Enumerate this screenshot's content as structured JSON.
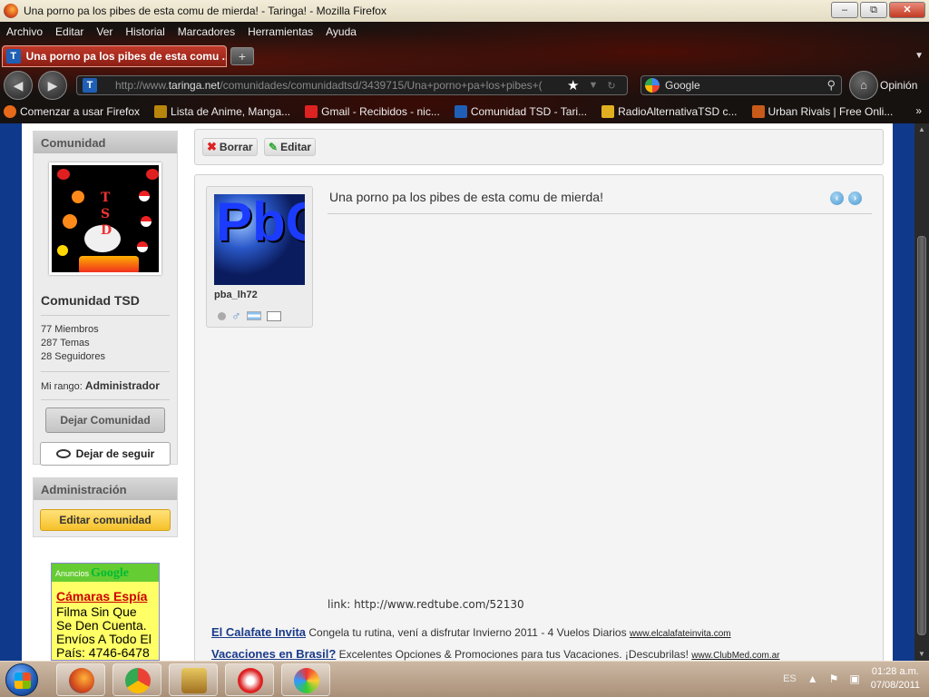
{
  "window": {
    "title": "Una porno pa los pibes de esta comu de mierda! - Taringa! - Mozilla Firefox",
    "minimize": "–",
    "maximize": "⧉",
    "close": "✕"
  },
  "menu": [
    "Archivo",
    "Editar",
    "Ver",
    "Historial",
    "Marcadores",
    "Herramientas",
    "Ayuda"
  ],
  "tab": {
    "favicon": "T",
    "label": "Una porno pa los pibes de esta comu ...",
    "close": "✕",
    "new_tab": "+"
  },
  "navbar": {
    "back": "◀",
    "forward": "▶",
    "site_icon": "T",
    "url_prefix": "http://www.",
    "url_domain": "taringa.net",
    "url_path": "/comunidades/comunidadtsd/3439715/Una+porno+pa+los+pibes+(",
    "search_text": "Google",
    "home_label": "⌂",
    "opinion": "Opinión"
  },
  "bookmarks": [
    {
      "label": "Comenzar a usar Firefox",
      "icon": "firefox-icon",
      "color": "#e66a1a"
    },
    {
      "label": "Lista de Anime, Manga...",
      "icon": "anime-icon",
      "color": "#b8860b"
    },
    {
      "label": "Gmail - Recibidos - nic...",
      "icon": "gmail-icon",
      "color": "#d22"
    },
    {
      "label": "Comunidad TSD - Tari...",
      "icon": "taringa-icon",
      "color": "#1f5fb5"
    },
    {
      "label": "RadioAlternativaTSD c...",
      "icon": "radio-icon",
      "color": "#e0b020"
    },
    {
      "label": "Urban Rivals | Free Onli...",
      "icon": "urban-icon",
      "color": "#c85a1a"
    }
  ],
  "bookmarks_more": "»",
  "sidebar": {
    "community_header": "Comunidad",
    "community_name": "Comunidad TSD",
    "logo_text": [
      "T",
      "S",
      "D"
    ],
    "stats": [
      "77 Miembros",
      "287 Temas",
      "28 Seguidores"
    ],
    "rank_label": "Mi rango:",
    "rank_value": "Administrador",
    "leave_button": "Dejar Comunidad",
    "unfollow_button": "Dejar de seguir",
    "admin_header": "Administración",
    "edit_button": "Editar comunidad"
  },
  "ad_box": {
    "label": "Anuncios",
    "brand": "Google",
    "title": "Cámaras Espía",
    "body": "Filma Sin Que Se Den Cuenta. Envíos A Todo El País: 4746-6478"
  },
  "toolbar": {
    "delete_label": "Borrar",
    "edit_label": "Editar"
  },
  "post": {
    "title": "Una porno pa los pibes de esta comu de mierda!",
    "author": "pba_lh72",
    "avatar_letters": "PbC",
    "prev": "‹",
    "next": "›",
    "link_text": "link: http://www.redtube.com/52130"
  },
  "ads": [
    {
      "headline": "El Calafate Invita",
      "text": " Congela tu rutina, vení a disfrutar Invierno 2011 - 4 Vuelos Diarios ",
      "url": "www.elcalafateinvita.com"
    },
    {
      "headline": "Vacaciones en Brasil?",
      "text": " Excelentes Opciones & Promociones para tus Vacaciones. ¡Descubrilas! ",
      "url": "www.ClubMed.com.ar"
    }
  ],
  "taskbar": {
    "language": "ES",
    "time": "01:28 a.m.",
    "date": "07/08/2011"
  }
}
